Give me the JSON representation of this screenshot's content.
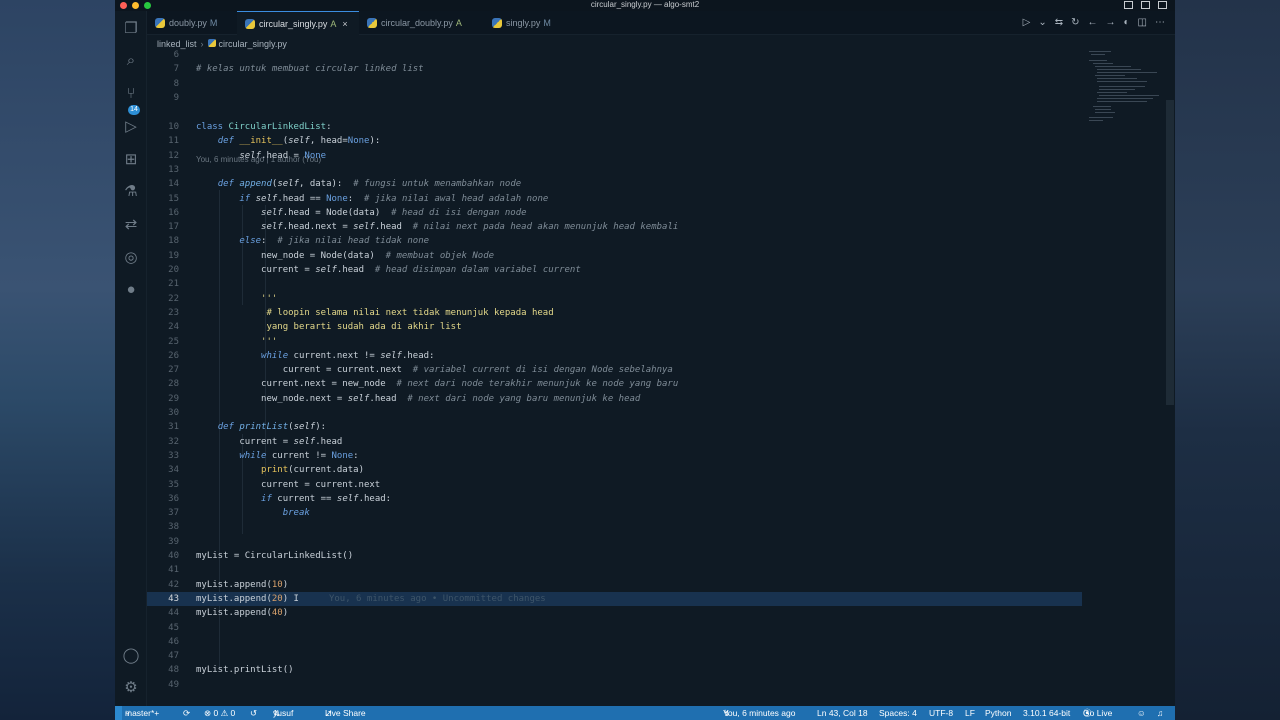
{
  "window": {
    "title": "circular_singly.py — algo-smt2"
  },
  "activity_bar": {
    "source_control_badge": "14",
    "icons": [
      "files-icon",
      "search-icon",
      "source-control-icon",
      "run-debug-icon",
      "extensions-icon",
      "testing-icon",
      "remote-icon",
      "gitlens-icon",
      "spotify-icon",
      "account-icon",
      "settings-gear-icon"
    ]
  },
  "tabs": [
    {
      "label": "doubly.py",
      "status": "M",
      "active": false
    },
    {
      "label": "circular_singly.py",
      "status": "A",
      "active": true
    },
    {
      "label": "circular_doubly.py",
      "status": "A",
      "active": false
    },
    {
      "label": "singly.py",
      "status": "M",
      "active": false
    }
  ],
  "breadcrumb": {
    "folder": "linked_list",
    "file": "circular_singly.py"
  },
  "editor": {
    "blame_header": "You, 6 minutes ago | 1 author (You)",
    "ghost_blame": "You, 6 minutes ago • Uncommitted changes",
    "current_line": 43,
    "line_numbers": [
      "6",
      "7",
      "8",
      "9",
      "10",
      "11",
      "12",
      "13",
      "14",
      "15",
      "16",
      "17",
      "18",
      "19",
      "20",
      "21",
      "22",
      "23",
      "24",
      "25",
      "26",
      "27",
      "28",
      "29",
      "30",
      "31",
      "32",
      "33",
      "34",
      "35",
      "36",
      "37",
      "38",
      "39",
      "40",
      "41",
      "42",
      "43",
      "44",
      "45",
      "46",
      "47",
      "48",
      "49"
    ]
  },
  "status_bar": {
    "branch": "master*+",
    "sync": "⟳",
    "problems": "⊗ 0 ⚠ 0",
    "user": "yusuf",
    "live_share": "Live Share",
    "blame": "You, 6 minutes ago",
    "cursor": "Ln 43, Col 18",
    "spaces": "Spaces: 4",
    "encoding": "UTF-8",
    "eol": "LF",
    "language": "Python",
    "interpreter": "3.10.1 64-bit",
    "go_live": "Go Live"
  },
  "colors": {
    "status_bar": "#1f6fb0",
    "editor_bg": "#0f1a24",
    "current_line": "#18324f"
  }
}
